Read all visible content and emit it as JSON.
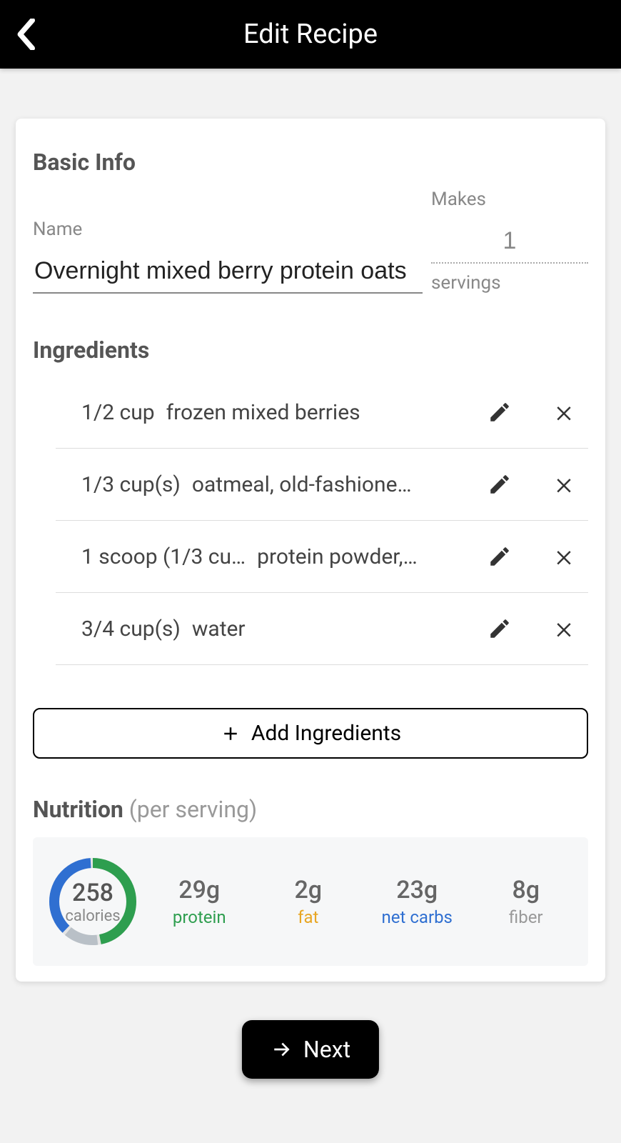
{
  "header": {
    "title": "Edit Recipe"
  },
  "basic": {
    "section_title": "Basic Info",
    "name_label": "Name",
    "name_value": "Overnight mixed berry protein oats",
    "makes_label": "Makes",
    "makes_value": "1",
    "makes_unit": "servings"
  },
  "ingredients": {
    "section_title": "Ingredients",
    "items": [
      {
        "qty": "1/2 cup",
        "name": "frozen mixed berries"
      },
      {
        "qty": "1/3 cup(s)",
        "name": "oatmeal, old-fashione…"
      },
      {
        "qty": "1 scoop (1/3 cu…",
        "name": "protein powder,…"
      },
      {
        "qty": "3/4 cup(s)",
        "name": "water"
      }
    ],
    "add_label": "Add Ingredients"
  },
  "nutrition": {
    "title": "Nutrition",
    "subtitle": "(per serving)",
    "calories_value": "258",
    "calories_label": "calories",
    "macros": {
      "protein": {
        "value": "29g",
        "label": "protein"
      },
      "fat": {
        "value": "2g",
        "label": "fat"
      },
      "net_carbs": {
        "value": "23g",
        "label": "net carbs"
      },
      "fiber": {
        "value": "8g",
        "label": "fiber"
      }
    },
    "ring_colors": {
      "protein": "#2e9e4f",
      "fat": "#e8a624",
      "carbs": "#2f6fd1",
      "fiber": "#b9c0c7"
    }
  },
  "footer": {
    "next_label": "Next"
  }
}
